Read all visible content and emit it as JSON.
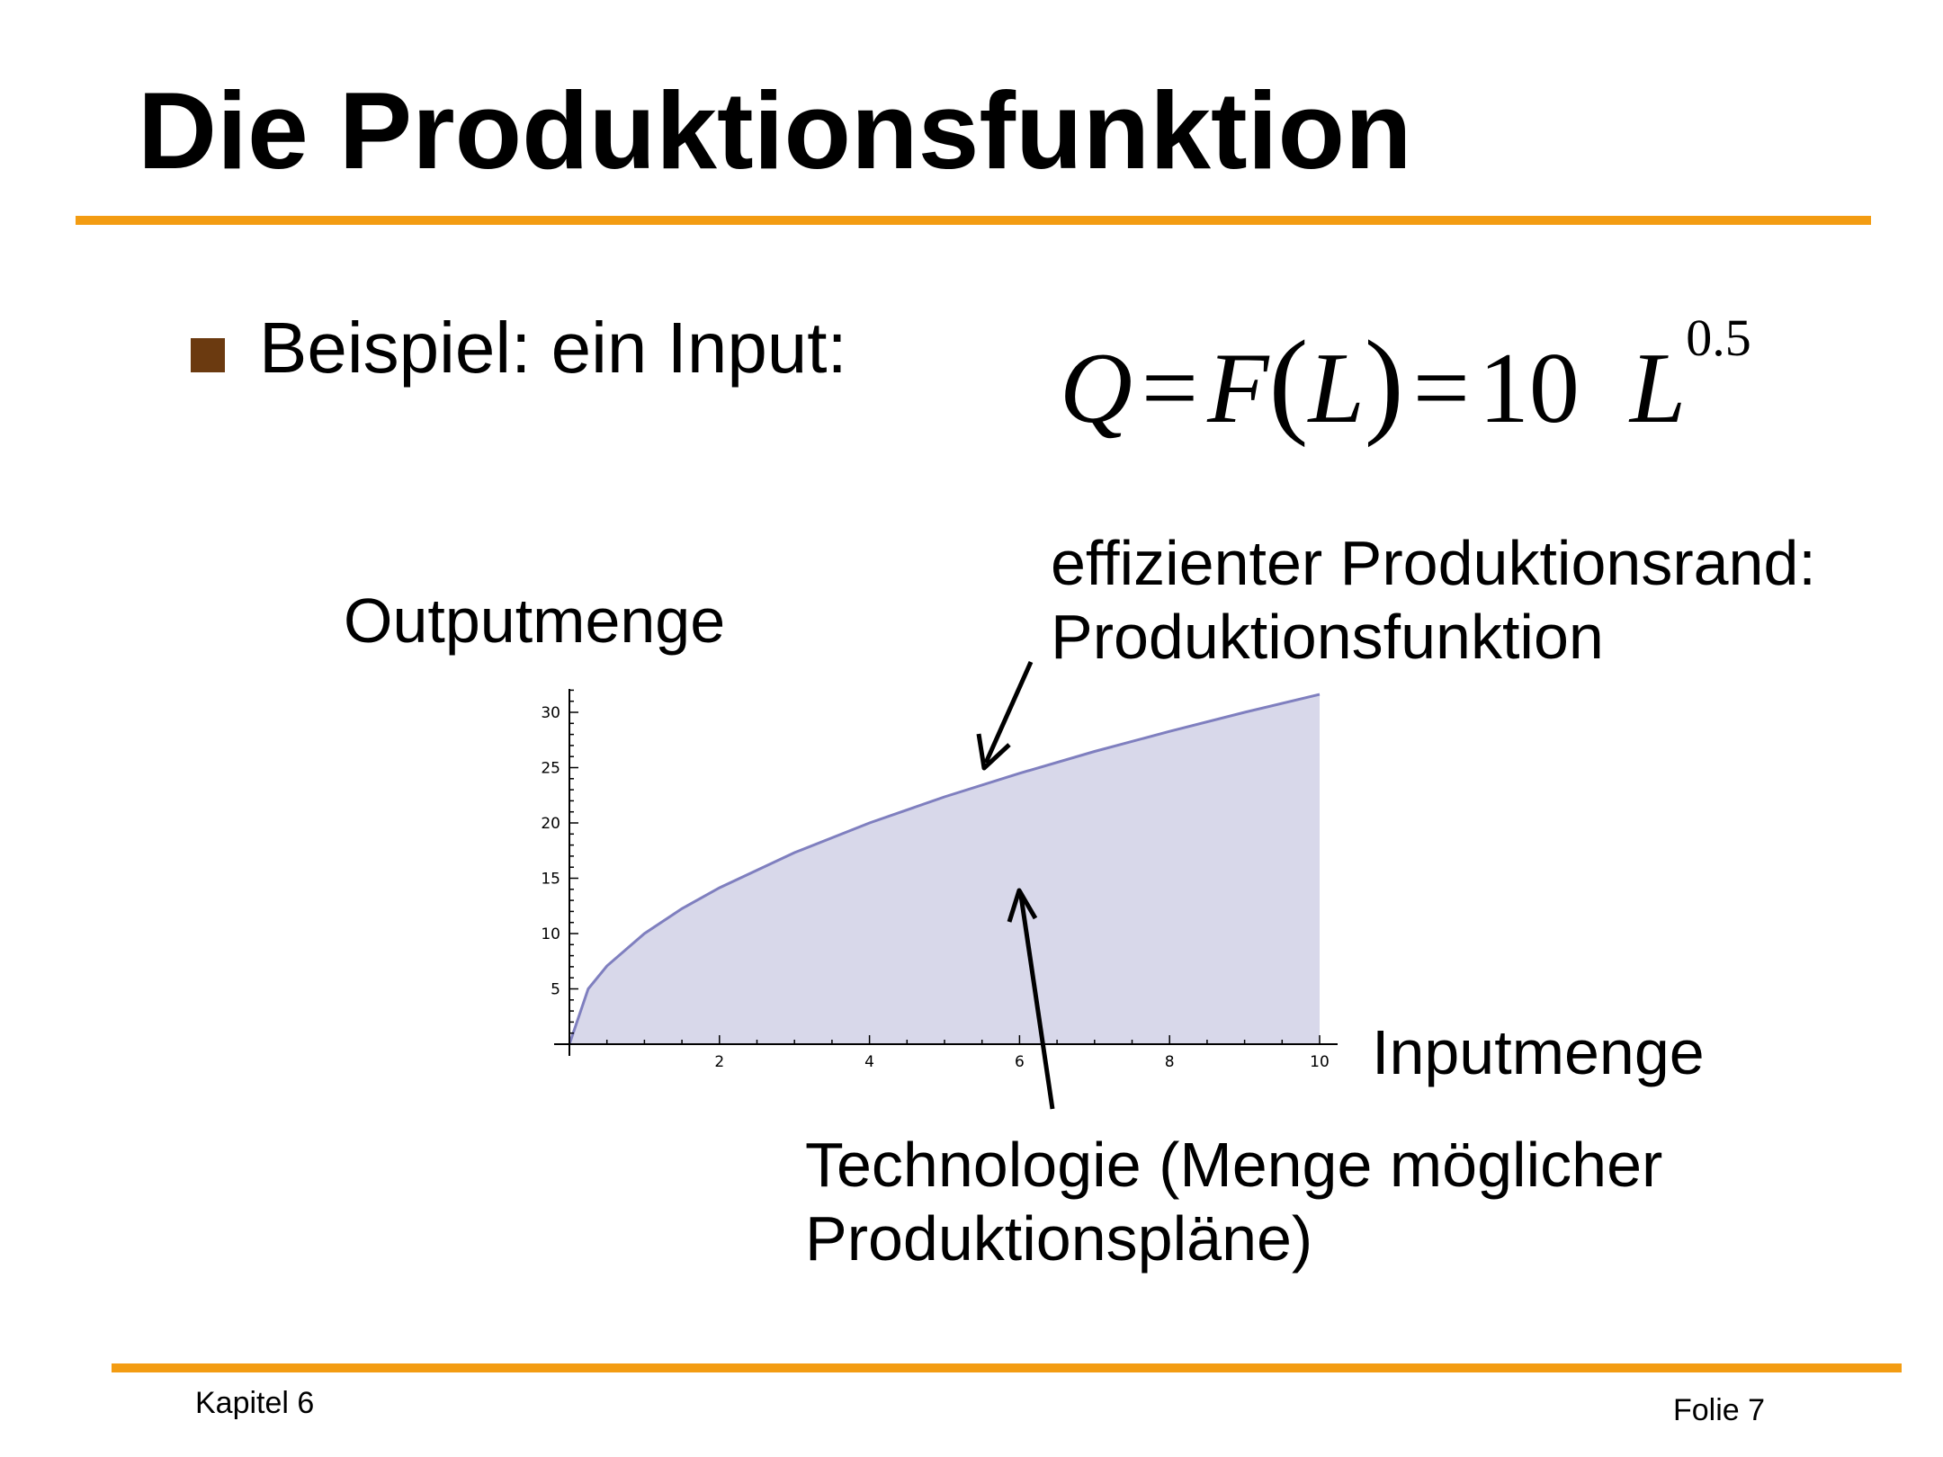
{
  "slide": {
    "title": "Die Produktionsfunktion",
    "accent_color": "#f39c12",
    "bullet_color": "#6b3a10",
    "bullet_text": "Beispiel: ein Input:",
    "formula": {
      "Q": "Q",
      "eq1": "=",
      "F": "F",
      "open_paren": "(",
      "L": "L",
      "close_paren": ")",
      "eq2": "=",
      "coef": "10",
      "base": "L",
      "exponent": "0.5"
    },
    "footer_left": "Kapitel 6",
    "footer_right": "Folie 7"
  },
  "chart_data": {
    "type": "area",
    "function": "Q = 10 * L^0.5",
    "x": [
      0,
      0.25,
      0.5,
      1,
      1.5,
      2,
      3,
      4,
      5,
      6,
      7,
      8,
      9,
      10
    ],
    "y": [
      0,
      5,
      7.07,
      10,
      12.25,
      14.14,
      17.32,
      20,
      22.36,
      24.49,
      26.46,
      28.28,
      30,
      31.62
    ],
    "xlabel": "Inputmenge",
    "ylabel": "Outputmenge",
    "xlim": [
      0,
      10
    ],
    "ylim": [
      0,
      30
    ],
    "x_ticks": [
      "2",
      "4",
      "6",
      "8",
      "10"
    ],
    "y_ticks": [
      "5",
      "10",
      "15",
      "20",
      "25",
      "30"
    ],
    "line_color": "#7f7fbf",
    "fill_color": "#d8d8ea",
    "annotations": [
      {
        "text_lines": [
          "effizienter Produktionsrand:",
          "Produktionsfunktion"
        ]
      },
      {
        "text_lines": [
          "Technologie (Menge möglicher",
          "Produktionspläne)"
        ]
      }
    ]
  }
}
